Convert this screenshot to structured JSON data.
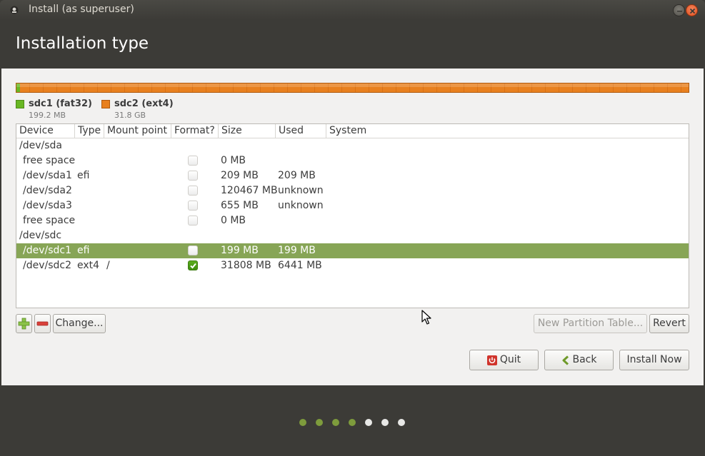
{
  "window": {
    "title": "Install (as superuser)"
  },
  "page": {
    "title": "Installation type"
  },
  "partition_bar": {
    "segments": [
      {
        "name": "sdc1 (fat32)",
        "size": "199.2 MB",
        "color": "#68b723"
      },
      {
        "name": "sdc2 (ext4)",
        "size": "31.8 GB",
        "color": "#e8801f"
      }
    ]
  },
  "table": {
    "columns": [
      "Device",
      "Type",
      "Mount point",
      "Format?",
      "Size",
      "Used",
      "System"
    ],
    "rows": [
      {
        "device": "/dev/sda",
        "type": "",
        "mount": "",
        "format": null,
        "size": "",
        "used": "",
        "group": true
      },
      {
        "device": "free space",
        "type": "",
        "mount": "",
        "format": false,
        "size": "0 MB",
        "used": ""
      },
      {
        "device": "/dev/sda1",
        "type": "efi",
        "mount": "",
        "format": false,
        "size": "209 MB",
        "used": "209 MB"
      },
      {
        "device": "/dev/sda2",
        "type": "",
        "mount": "",
        "format": false,
        "size": "120467 MB",
        "used": "unknown"
      },
      {
        "device": "/dev/sda3",
        "type": "",
        "mount": "",
        "format": false,
        "size": "655 MB",
        "used": "unknown"
      },
      {
        "device": "free space",
        "type": "",
        "mount": "",
        "format": false,
        "size": "0 MB",
        "used": ""
      },
      {
        "device": "/dev/sdc",
        "type": "",
        "mount": "",
        "format": null,
        "size": "",
        "used": "",
        "group": true
      },
      {
        "device": "/dev/sdc1",
        "type": "efi",
        "mount": "",
        "format": false,
        "size": "199 MB",
        "used": "199 MB",
        "selected": true
      },
      {
        "device": "/dev/sdc2",
        "type": "ext4",
        "mount": "/",
        "format": true,
        "size": "31808 MB",
        "used": "6441 MB"
      }
    ]
  },
  "buttons": {
    "add_icon": "plus-icon",
    "remove_icon": "minus-icon",
    "change": "Change...",
    "new_partition_table": "New Partition Table...",
    "revert": "Revert",
    "quit": "Quit",
    "back": "Back",
    "install_now": "Install Now"
  },
  "progress": {
    "total_steps": 7,
    "completed_steps": 4
  },
  "colors": {
    "selected_row": "#87a556",
    "checkbox_checked": "#4e9e17",
    "progress_done": "#7e9c3c",
    "progress_todo": "#e8e8e6"
  }
}
